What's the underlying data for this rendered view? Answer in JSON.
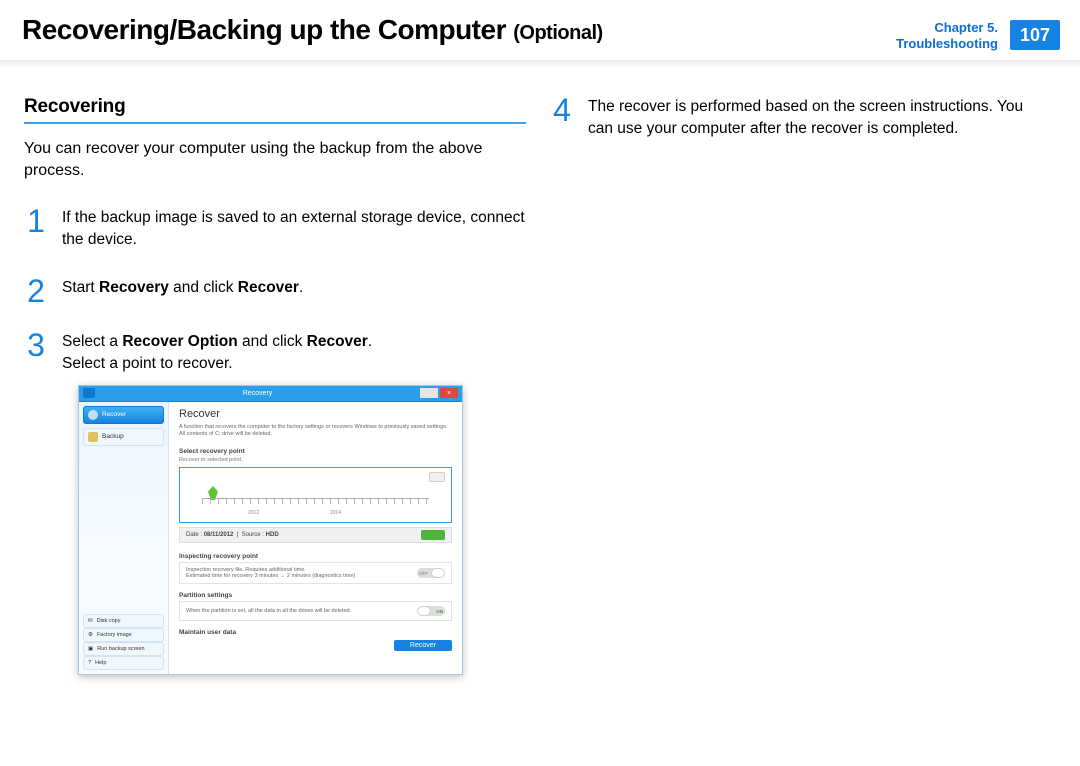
{
  "header": {
    "title_main": "Recovering/Backing up the Computer",
    "title_sub": "(Optional)",
    "chapter_line": "Chapter 5.",
    "section_line": "Troubleshooting",
    "page_num": "107"
  },
  "left": {
    "subhead": "Recovering",
    "lead": "You can recover your computer using the backup from the above process.",
    "steps": [
      {
        "num": "1",
        "html": "If the backup image is saved to an external storage device, connect the device."
      },
      {
        "num": "2",
        "html": "Start <b>Recovery</b> and click <b>Recover</b>."
      },
      {
        "num": "3",
        "html": "Select a <b>Recover Option</b> and click <b>Recover</b>.<br>Select a point to recover."
      }
    ],
    "shot": {
      "title": "Recovery",
      "close": "×",
      "side": {
        "recover": "Recover",
        "backup": "Backup",
        "disk_copy": "Disk copy",
        "factory_image": "Factory image",
        "run_backup": "Run backup screen",
        "help": "Help"
      },
      "main": {
        "h3": "Recover",
        "desc": "A function that recovers the computer to the factory settings or recovers Windows to previously saved settings. All contents of C: drive will be deleted.",
        "sel_pt_label": "Select recovery point",
        "sel_pt_sub": "Recover to selected point.",
        "yr1": "2012",
        "yr2": "2014",
        "status_date_l": "Date :",
        "status_date_v": "08/11/2012",
        "status_src_l": "Source :",
        "status_src_v": "HDD",
        "insp_label": "Inspecting recovery point",
        "insp_desc": "Inspection recovery file. Requires additional time.\nEstimated time for recovery 3 minutes → 2 minutes (diagnostics time)",
        "part_label": "Partition settings",
        "part_desc": "When the partition is set, all the data in all the drives will be deleted.",
        "maint_label": "Maintain user data",
        "off": "OFF",
        "on": "ON",
        "recover_btn": "Recover"
      }
    }
  },
  "right": {
    "step4_num": "4",
    "step4_html": "The recover is performed based on the screen instructions. You can use your computer after the recover is completed."
  }
}
